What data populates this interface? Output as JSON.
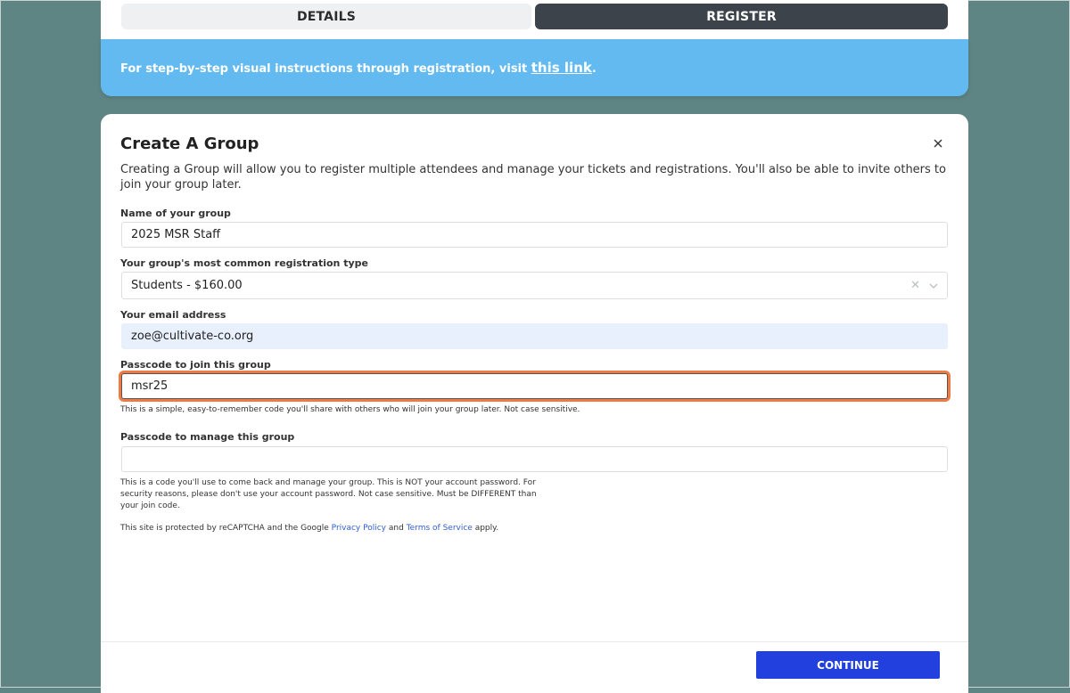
{
  "tabs": [
    {
      "label": "DETAILS",
      "active": false
    },
    {
      "label": "REGISTER",
      "active": true
    }
  ],
  "banner": {
    "text": "For step-by-step visual instructions through registration, visit ",
    "link_text": "this link",
    "end": "."
  },
  "modal": {
    "title": "Create A Group",
    "close_icon": "close-icon",
    "intro": "Creating a Group will allow you to register multiple attendees and manage your tickets and registrations. You'll also be able to invite others to join your group later.",
    "group_name": {
      "label": "Name of your group",
      "value": "2025 MSR Staff"
    },
    "reg_type": {
      "label": "Your group's most common registration type",
      "value": "Students - $160.00"
    },
    "email": {
      "label": "Your email address",
      "value": "zoe@cultivate-co.org"
    },
    "join_code": {
      "label": "Passcode to join this group",
      "value": "msr25",
      "help": "This is a simple, easy-to-remember code you'll share with others who will join your group later. Not case sensitive."
    },
    "manage_code": {
      "label": "Passcode to manage this group",
      "value": "",
      "help_line1": "This is a code you'll use to come back and manage your group. This is NOT your account password. For",
      "help_line2": "security reasons, please don't use your account password. Not case sensitive. Must be DIFFERENT than",
      "help_line3": "your join code."
    },
    "recaptcha": {
      "prefix": "This site is protected by reCAPTCHA and the Google ",
      "privacy": "Privacy Policy",
      "and": " and ",
      "terms": "Terms of Service",
      "suffix": " apply."
    },
    "continue_label": "CONTINUE"
  },
  "colors": {
    "background": "#5e8584",
    "banner": "#63baf0",
    "tab_active": "#3d434b",
    "primary_button": "#2140de",
    "focus_ring": "#f07a43",
    "autofill": "#e8f0fe"
  }
}
